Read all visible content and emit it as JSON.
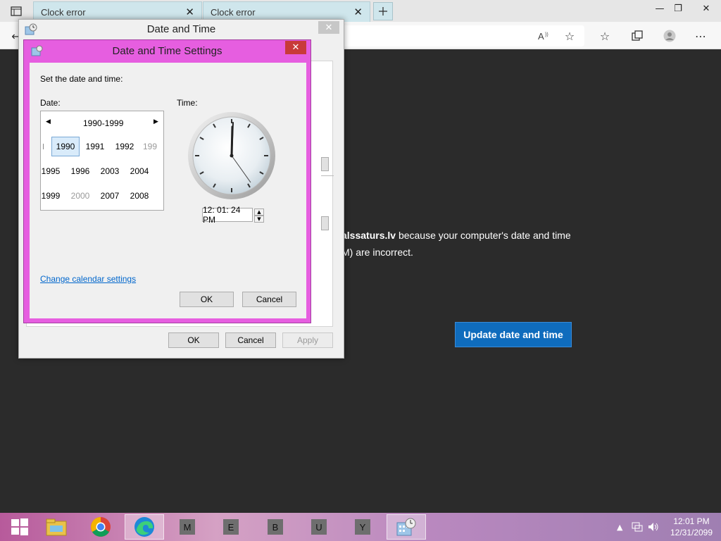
{
  "browser": {
    "tabs": [
      {
        "label": "Clock error"
      },
      {
        "label": "Clock error"
      }
    ]
  },
  "page": {
    "msg_line1_bold": "alssaturs.lv",
    "msg_line1_rest": " because your computer's date and time",
    "msg_line2": "M) are incorrect.",
    "update_button": "Update date and time"
  },
  "dt_dialog": {
    "title": "Date and Time",
    "ok": "OK",
    "cancel": "Cancel",
    "apply": "Apply"
  },
  "settings_dialog": {
    "title": "Date and Time Settings",
    "prompt": "Set the date and time:",
    "date_label": "Date:",
    "time_label": "Time:",
    "calendar": {
      "header": "1990-1999",
      "rows": [
        [
          {
            "t": "1990",
            "s": "sel"
          },
          {
            "t": "1991",
            "s": ""
          },
          {
            "t": "1992",
            "s": ""
          },
          {
            "t": "199",
            "s": "dim"
          }
        ],
        [
          {
            "t": "1995",
            "s": ""
          },
          {
            "t": "1996",
            "s": ""
          },
          {
            "t": "2003",
            "s": ""
          },
          {
            "t": "2004",
            "s": ""
          }
        ],
        [
          {
            "t": "1999",
            "s": ""
          },
          {
            "t": "2000",
            "s": "dim"
          },
          {
            "t": "2007",
            "s": ""
          },
          {
            "t": "2008",
            "s": ""
          }
        ]
      ]
    },
    "time_value": "12: 01: 24 PM",
    "change_calendar_link": "Change calendar settings",
    "ok": "OK",
    "cancel": "Cancel"
  },
  "taskbar": {
    "letters": [
      "M",
      "E",
      "B",
      "U",
      "Y"
    ],
    "time": "12:01 PM",
    "date": "12/31/2099"
  },
  "colors": {
    "settings_frame": "#e65ee0",
    "update_button": "#0f6cbd"
  }
}
